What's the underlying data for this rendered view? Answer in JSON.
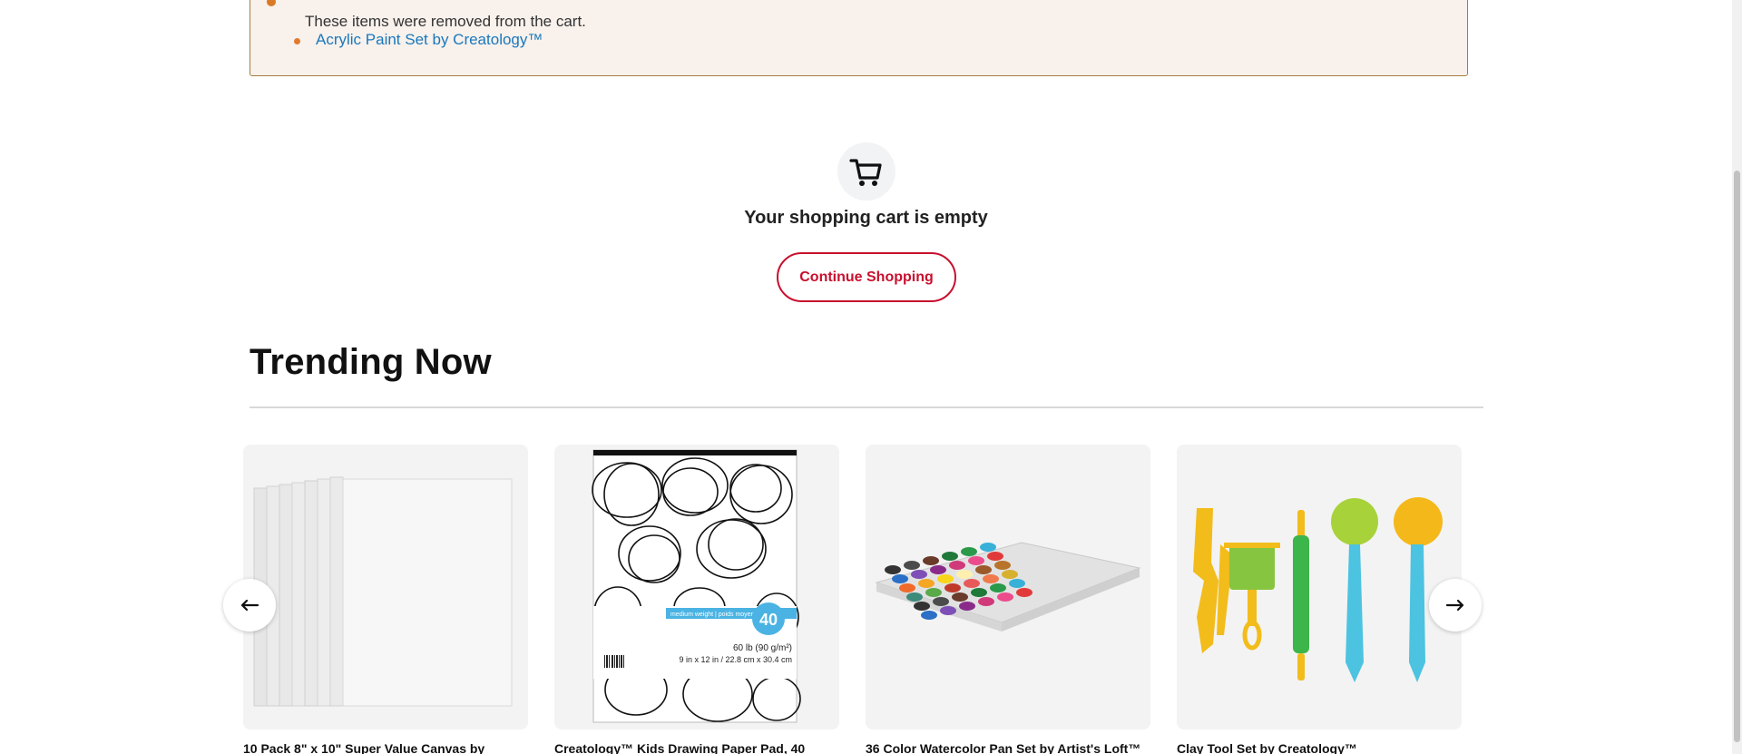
{
  "notice": {
    "message": "These items were removed from the cart.",
    "removed_items": [
      "Acrylic Paint Set by Creatology™"
    ]
  },
  "empty_cart": {
    "title": "Your shopping cart is empty",
    "continue_label": "Continue Shopping"
  },
  "trending": {
    "title": "Trending Now",
    "products": [
      {
        "title": "10 Pack 8\" x 10\" Super Value Canvas by",
        "image": "canvas-pack-image"
      },
      {
        "title": "Creatology™ Kids Drawing Paper Pad, 40",
        "image": "drawing-pad-image"
      },
      {
        "title": "36 Color Watercolor Pan Set by Artist's Loft™",
        "image": "watercolor-set-image"
      },
      {
        "title": "Clay Tool Set by Creatology™",
        "image": "clay-tools-image"
      }
    ],
    "drawing_pad_label": {
      "count": "40",
      "weight": "60 lb (90 g/m²)",
      "size": "9 in x 12 in / 22.8 cm x 30.4 cm",
      "band": "medium weight | poids moyen"
    }
  },
  "colors": {
    "accent": "#c8102e",
    "link": "#1a78bc",
    "notice_bg": "#f8f1ec",
    "notice_border": "#a87d3d"
  }
}
